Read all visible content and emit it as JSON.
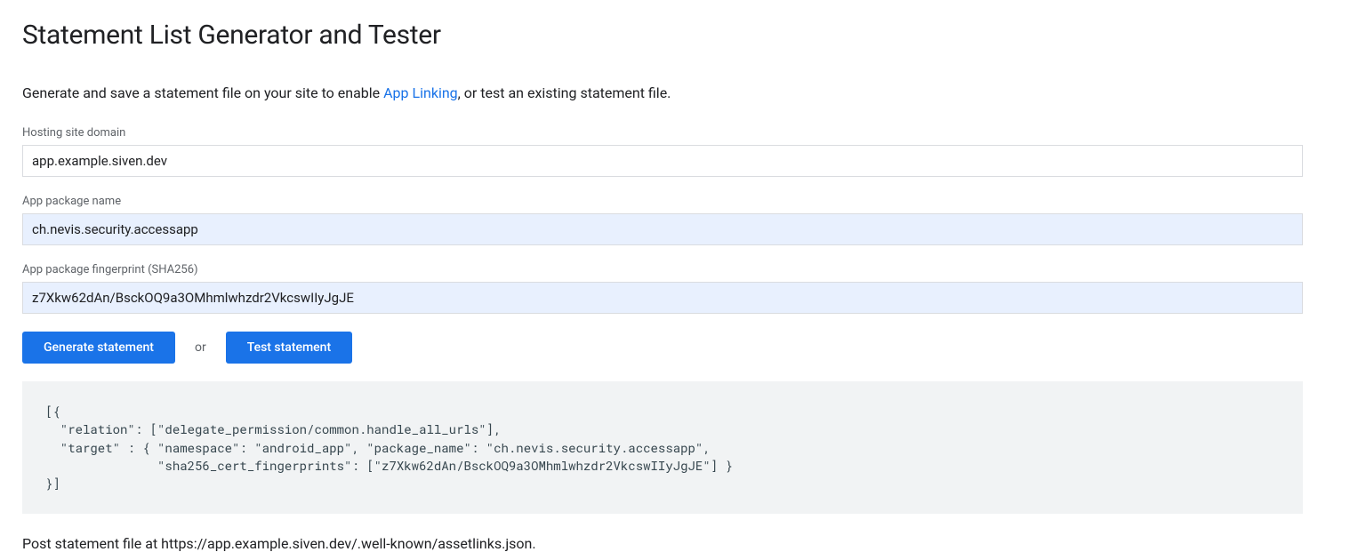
{
  "title": "Statement List Generator and Tester",
  "intro": {
    "before": "Generate and save a statement file on your site to enable ",
    "link": "App Linking",
    "after": ", or test an existing statement file."
  },
  "fields": {
    "domain": {
      "label": "Hosting site domain",
      "value": "app.example.siven.dev"
    },
    "package": {
      "label": "App package name",
      "value": "ch.nevis.security.accessapp"
    },
    "fingerprint": {
      "label": "App package fingerprint (SHA256)",
      "value": "z7Xkw62dAn/BsckOQ9a3OMhmlwhzdr2VkcswIIyJgJE"
    }
  },
  "buttons": {
    "generate": "Generate statement",
    "or": "or",
    "test": "Test statement"
  },
  "code_output": "[{\n  \"relation\": [\"delegate_permission/common.handle_all_urls\"],\n  \"target\" : { \"namespace\": \"android_app\", \"package_name\": \"ch.nevis.security.accessapp\",\n               \"sha256_cert_fingerprints\": [\"z7Xkw62dAn/BsckOQ9a3OMhmlwhzdr2VkcswIIyJgJE\"] }\n}]",
  "post_note": "Post statement file at https://app.example.siven.dev/.well-known/assetlinks.json."
}
